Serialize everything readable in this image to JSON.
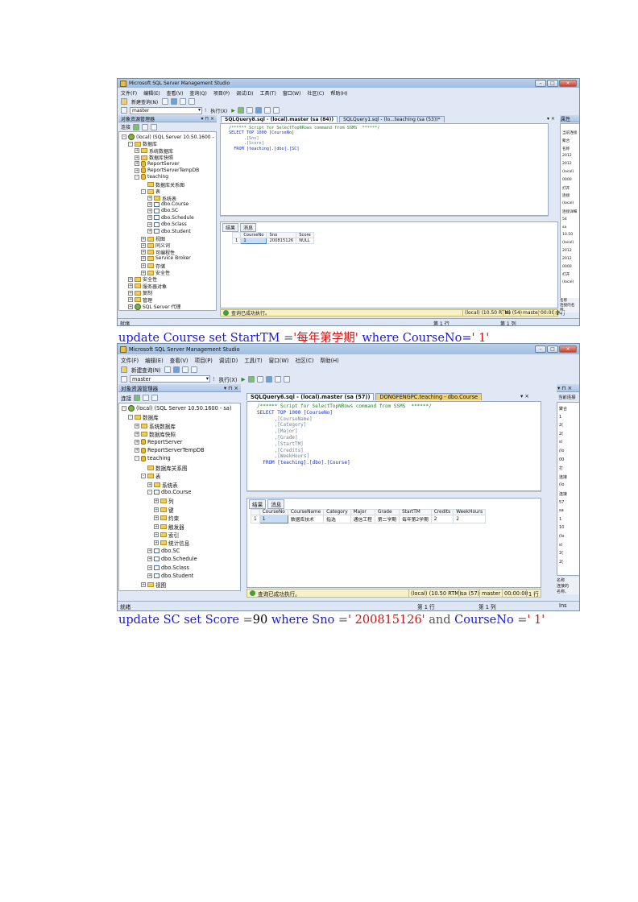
{
  "window1": {
    "title": "Microsoft SQL Server Management Studio",
    "menu": [
      "文件(F)",
      "编辑(E)",
      "查看(V)",
      "查询(Q)",
      "项目(P)",
      "调试(D)",
      "工具(T)",
      "窗口(W)",
      "社区(C)",
      "帮助(H)"
    ],
    "toolbar": {
      "new_query": "新建查询(N)",
      "database": "master",
      "execute": "执行(X)"
    },
    "explorer_title": "对象资源管理器",
    "connect_label": "连接",
    "tree": [
      "(local) (SQL Server 10.50.1600 - sa)",
      "数据库",
      "系统数据库",
      "数据库快照",
      "ReportServer",
      "ReportServerTempDB",
      "teaching",
      "数据库关系图",
      "表",
      "系统表",
      "dbo.Course",
      "dbo.SC",
      "dbo.Schedule",
      "dbo.Sclass",
      "dbo.Student",
      "视图",
      "同义词",
      "可编程性",
      "Service Broker",
      "存储",
      "安全性",
      "安全性",
      "服务器对象",
      "复制",
      "管理",
      "SQL Server 代理"
    ],
    "tabs": [
      "SQLQuery8.sql - (local).master (sa (84))",
      "SQLQuery1.sql - (lo...teaching (sa (53))*"
    ],
    "sql": [
      "/****** Script for SelectTopNRows command from SSMS  ******/",
      "SELECT TOP 1000 [CourseNo]",
      "      ,[Sno]",
      "      ,[Score]",
      "  FROM [teaching].[dbo].[SC]"
    ],
    "results_tab": "结果",
    "messages_tab": "消息",
    "grid": {
      "columns": [
        "CourseNo",
        "Sno",
        "Score"
      ],
      "rows": [
        [
          "1",
          "1",
          "200815126",
          "NULL"
        ]
      ]
    },
    "status_text": "查询已成功执行。",
    "status_segments": [
      "(local) (10.50 RTM)",
      "sa (54)",
      "master",
      "00:00:00",
      "1 行"
    ],
    "app_status": {
      "ready": "就绪",
      "row": "第 1 行",
      "col": "第 1 列"
    },
    "props_head": "属性",
    "props_lines": [
      "当前连接",
      "聚合",
      "名称",
      "2012",
      "2012",
      "(local)",
      "0000",
      "打开",
      "连接",
      "(local)",
      "连接详细",
      "54",
      "sa",
      "10.50",
      "(local)",
      "2012",
      "2012",
      "0000",
      "打开",
      "(local)"
    ],
    "props_bottom": [
      "名称",
      "连接的名称。"
    ]
  },
  "caption1": {
    "kw1": "update",
    "t1": "Course",
    "kw2": "set",
    "t2": "StartTM",
    "eq": "=",
    "str1": "'每年第学期'",
    "kw3": "where",
    "t3": "CourseNo=",
    "str2": "' 1'"
  },
  "window2": {
    "title": "Microsoft SQL Server Management Studio",
    "menu": [
      "文件(F)",
      "编辑(E)",
      "查看(V)",
      "项目(P)",
      "调试(D)",
      "工具(T)",
      "窗口(W)",
      "社区(C)",
      "帮助(H)"
    ],
    "toolbar": {
      "new_query": "新建查询(N)",
      "database": "master",
      "execute": "执行(X)"
    },
    "explorer_title": "对象资源管理器",
    "connect_label": "连接",
    "tree": [
      "(local) (SQL Server 10.50.1600 - sa)",
      "数据库",
      "系统数据库",
      "数据库快照",
      "ReportServer",
      "ReportServerTempDB",
      "teaching",
      "数据库关系图",
      "表",
      "系统表",
      "dbo.Course",
      "列",
      "键",
      "约束",
      "触发器",
      "索引",
      "统计信息",
      "dbo.SC",
      "dbo.Schedule",
      "dbo.Sclass",
      "dbo.Student",
      "视图"
    ],
    "tabs": [
      "SQLQuery6.sql - (local).master (sa (57))",
      "DONGFENGPC.teaching - dbo.Course"
    ],
    "sql": [
      "/****** Script for SelectTopNRows command from SSMS  ******/",
      "SELECT TOP 1000 [CourseNo]",
      "      ,[CourseName]",
      "      ,[Category]",
      "      ,[Major]",
      "      ,[Grade]",
      "      ,[StartTM]",
      "      ,[Credits]",
      "      ,[WeekHours]",
      "  FROM [teaching].[dbo].[Course]"
    ],
    "results_tab": "结果",
    "messages_tab": "消息",
    "grid": {
      "columns": [
        "CourseNo",
        "CourseName",
        "Category",
        "Major",
        "Grade",
        "StartTM",
        "Credits",
        "WeekHours"
      ],
      "rows": [
        [
          "1",
          "1",
          "数据库技术",
          "指选",
          "通信工程",
          "第二学期",
          "每年第2学期",
          "2",
          "2"
        ]
      ]
    },
    "status_text": "查询已成功执行。",
    "status_segments": [
      "(local) (10.50 RTM)",
      "sa (57)",
      "master",
      "00:00:00",
      "1 行"
    ],
    "app_status": {
      "ready": "就绪",
      "row": "第 1 行",
      "col": "第 1 列",
      "ins": "Ins"
    },
    "props_head": "当前连接",
    "props_lines": [
      "聚合",
      "1",
      "2(",
      "2(",
      "sl",
      "(lo",
      "00",
      "打",
      "连接",
      "(lo",
      "连接",
      "57",
      "sa",
      "1",
      "10",
      "(lo",
      "sl",
      "2(",
      "2("
    ],
    "props_bottom": [
      "名称",
      "连接的",
      "名称。"
    ]
  },
  "caption2": {
    "kw1": "update",
    "t1": "SC",
    "kw2": "set",
    "t2": "Score",
    "eq": "=",
    "num": "90",
    "kw3": "where",
    "t3": "Sno",
    "eq2": "=",
    "str1": "' 200815126'",
    "and": "and",
    "t4": "CourseNo",
    "eq3": "=",
    "str2": "' 1'"
  }
}
